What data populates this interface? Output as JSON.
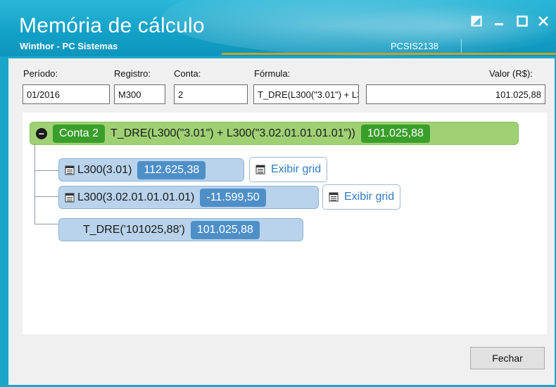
{
  "window": {
    "title": "Memória de cálculo",
    "subtitle": "Winthor - PC Sistemas",
    "code": "PCSIS2138",
    "controls": [
      "restore-icon",
      "minimize-icon",
      "maximize-icon",
      "close-icon"
    ]
  },
  "fields": {
    "periodo": {
      "label": "Período:",
      "value": "01/2016"
    },
    "registro": {
      "label": "Registro:",
      "value": "M300"
    },
    "conta": {
      "label": "Conta:",
      "value": "2"
    },
    "formula": {
      "label": "Fórmula:",
      "value": "T_DRE(L300(\"3.01\") + L300(\"3.02.01.01.01.01\"))"
    },
    "valor": {
      "label": "Valor (R$):",
      "value": "101.025,88"
    }
  },
  "tree": {
    "root": {
      "account": "Conta 2",
      "formula": "T_DRE(L300(\"3.01\") + L300(\"3.02.01.01.01.01\"))",
      "value": "101.025,88"
    },
    "children": [
      {
        "label": "L300(3.01)",
        "value": "112.625,38",
        "action": "Exibir grid"
      },
      {
        "label": "L300(3.02.01.01.01.01)",
        "value": "-11.599,50",
        "action": "Exibir grid"
      },
      {
        "label": "T_DRE('101025,88')",
        "value": "101.025,88"
      }
    ]
  },
  "buttons": {
    "close": "Fechar"
  },
  "colors": {
    "accent": "#1aa6c9",
    "root_node": "#9fd174",
    "child_node": "#b9d3ec",
    "value_badge": "#4e8fc8",
    "account_badge": "#3a9e2b"
  }
}
